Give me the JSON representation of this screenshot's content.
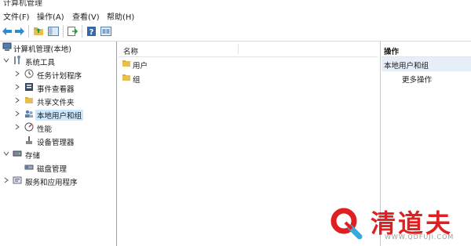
{
  "window": {
    "title": "计算机管理"
  },
  "menu": [
    "文件(F)",
    "操作(A)",
    "查看(V)",
    "帮助(H)"
  ],
  "toolbar": {
    "icons": [
      "back-icon",
      "forward-icon",
      "up-folder-icon",
      "show-hide-tree-icon",
      "export-list-icon",
      "help-icon",
      "properties-icon"
    ]
  },
  "tree": {
    "root": "计算机管理(本地)",
    "system_tools": "系统工具",
    "task_scheduler": "任务计划程序",
    "event_viewer": "事件查看器",
    "shared_folders": "共享文件夹",
    "local_users_groups": "本地用户和组",
    "performance": "性能",
    "device_manager": "设备管理器",
    "storage": "存储",
    "disk_management": "磁盘管理",
    "services_apps": "服务和应用程序"
  },
  "list": {
    "header_name": "名称",
    "items": [
      "用户",
      "组"
    ]
  },
  "actions": {
    "header": "操作",
    "group": "本地用户和组",
    "more": "更多操作"
  },
  "watermark": {
    "brand": "清道夫",
    "url": "WWW.QDFUJI.COM"
  }
}
